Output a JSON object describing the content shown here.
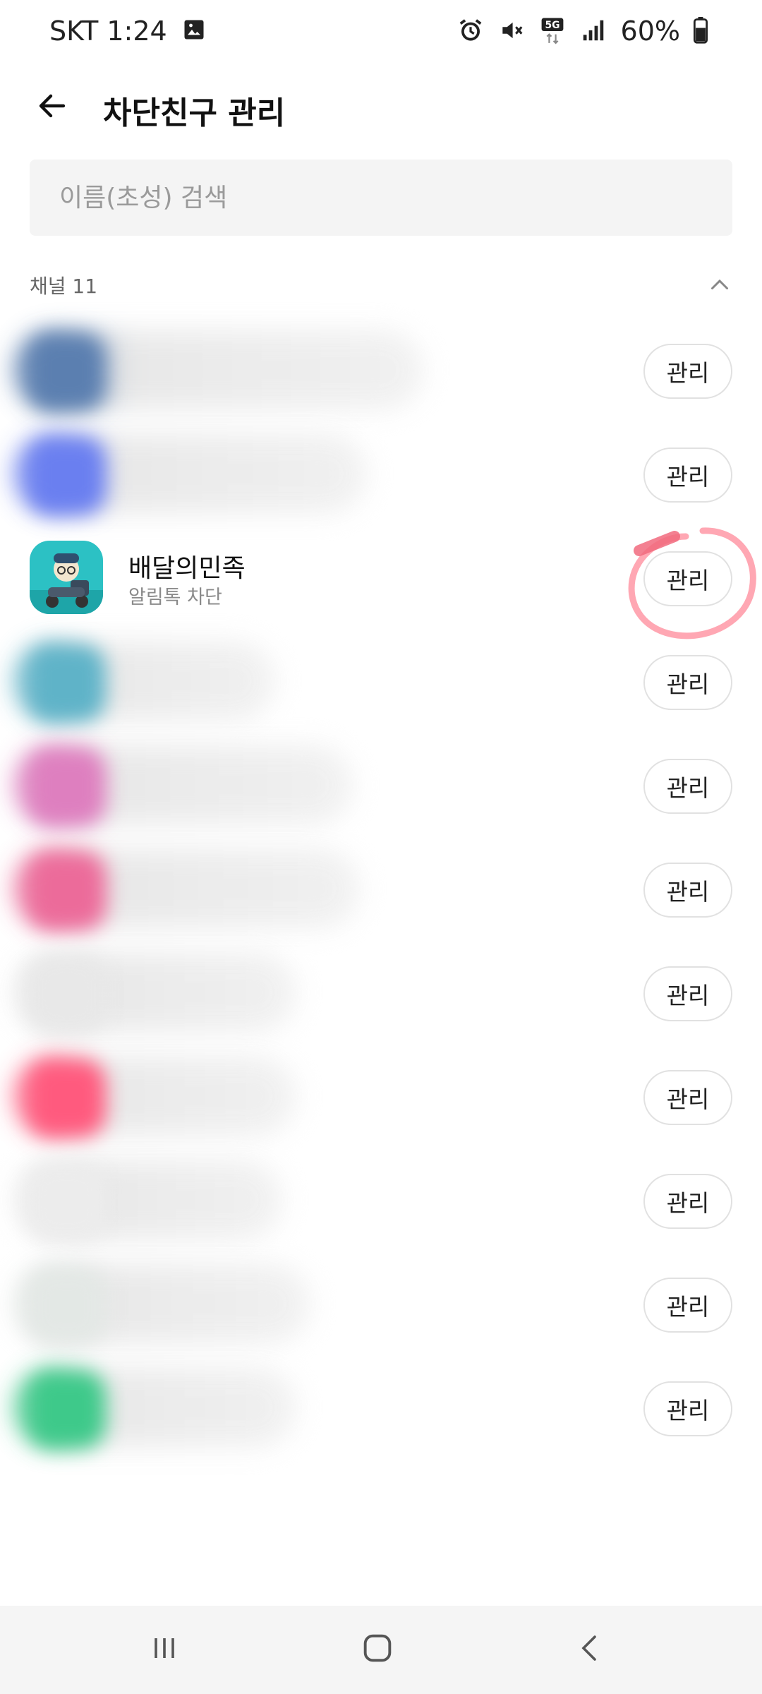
{
  "status_bar": {
    "carrier_time": "SKT 1:24",
    "network": "5G",
    "battery": "60%",
    "icons": [
      "image-icon",
      "alarm-icon",
      "mute-icon",
      "5g-icon",
      "signal-icon",
      "battery-icon"
    ]
  },
  "header": {
    "title": "차단친구 관리",
    "back_icon": "arrow-left-icon"
  },
  "search": {
    "placeholder": "이름(초성) 검색",
    "value": ""
  },
  "section": {
    "label": "채널 11",
    "collapse_icon": "chevron-up-icon"
  },
  "manage_label": "관리",
  "rows": [
    {
      "blurred": true,
      "color": "#5b7fb0",
      "manage": "관리"
    },
    {
      "blurred": true,
      "color": "#6a7ff0",
      "manage": "관리"
    },
    {
      "blurred": false,
      "name": "배달의민족",
      "subtitle": "알림톡 차단",
      "manage": "관리",
      "highlighted": true
    },
    {
      "blurred": true,
      "color": "#5fb3c8",
      "manage": "관리"
    },
    {
      "blurred": true,
      "color": "#de7fbf",
      "manage": "관리"
    },
    {
      "blurred": true,
      "color": "#ec6b9a",
      "manage": "관리"
    },
    {
      "blurred": true,
      "color": "#e8e8e8",
      "manage": "관리"
    },
    {
      "blurred": true,
      "color": "#ff5a7e",
      "manage": "관리"
    },
    {
      "blurred": true,
      "color": "#ececec",
      "manage": "관리"
    },
    {
      "blurred": true,
      "color": "#e3e8e5",
      "manage": "관리"
    },
    {
      "blurred": true,
      "color": "#3ec98a",
      "manage": "관리"
    }
  ],
  "colors": {
    "accent_highlight": "#ff8a9a",
    "app_icon_bg": "#2cc1c4"
  },
  "nav": {
    "recents_icon": "recent-apps-icon",
    "home_icon": "home-icon",
    "back_icon": "back-chevron-icon"
  }
}
